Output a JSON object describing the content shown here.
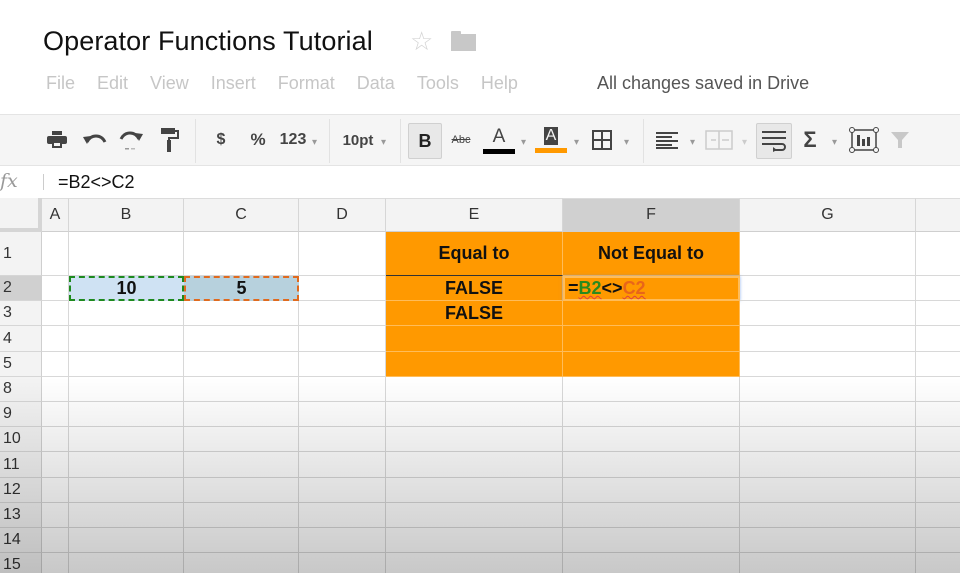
{
  "document": {
    "title": "Operator Functions Tutorial",
    "star_icon": "star-outline-icon",
    "folder_icon": "folder-icon",
    "save_status": "All changes saved in Drive"
  },
  "menu": [
    "File",
    "Edit",
    "View",
    "Insert",
    "Format",
    "Data",
    "Tools",
    "Help"
  ],
  "toolbar": {
    "currency_label": "$",
    "percent_label": "%",
    "number_format_label": "123",
    "font_size": "10pt",
    "bold_label": "B",
    "strikethrough_label": "Abc",
    "text_color_label": "A",
    "fill_color_label": "A",
    "text_color": "#000000",
    "fill_color": "#ff9900",
    "sum_label": "Σ",
    "caret": "▾"
  },
  "formula_bar": {
    "fx_label": "fx",
    "value": "=B2<>C2"
  },
  "grid": {
    "columns": [
      "A",
      "B",
      "C",
      "D",
      "E",
      "F",
      "G"
    ],
    "selected_column": "F",
    "rows": [
      "1",
      "2",
      "3",
      "4",
      "5",
      "8",
      "9",
      "10",
      "11",
      "12",
      "13",
      "14",
      "15"
    ],
    "selected_row": "2",
    "cells": {
      "B2": "10",
      "C2": "5",
      "E1": "Equal to",
      "F1": "Not Equal to",
      "E2": "FALSE",
      "E3": "FALSE"
    },
    "editing_cell": {
      "ref": "F2",
      "tokens": [
        "=",
        "B2",
        "<>",
        "C2"
      ]
    },
    "fill_color": "#ff9900",
    "ref_colors": {
      "B2": "#1e8a1e",
      "C2": "#e06a1e"
    }
  }
}
